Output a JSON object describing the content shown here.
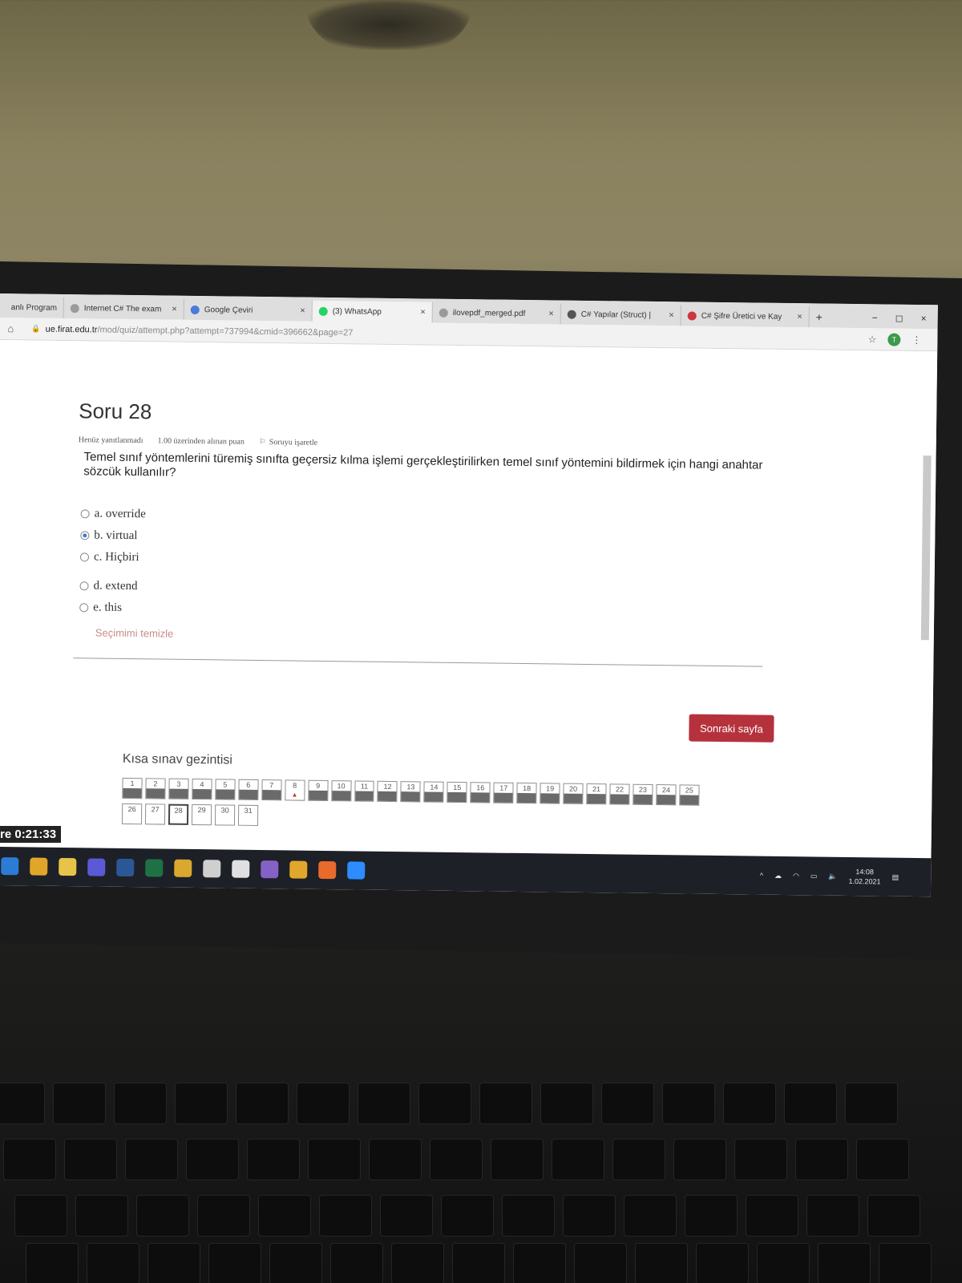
{
  "browser": {
    "tabs": [
      {
        "label": "anlı Program",
        "icon_color": "#888888",
        "active": false
      },
      {
        "label": "Internet C# The exam",
        "icon_color": "#9a9a9a",
        "active": false
      },
      {
        "label": "Google Çeviri",
        "icon_color": "#4a7bd8",
        "active": false
      },
      {
        "label": "(3) WhatsApp",
        "icon_color": "#25d366",
        "active": true
      },
      {
        "label": "ilovepdf_merged.pdf",
        "icon_color": "#9a9a9a",
        "active": false
      },
      {
        "label": "C# Yapılar (Struct) |",
        "icon_color": "#555555",
        "active": false
      },
      {
        "label": "C# Şifre Üretici ve Kay",
        "icon_color": "#d2343c",
        "active": false
      }
    ],
    "new_tab_label": "+",
    "close_label": "×",
    "window_controls": {
      "minimize": "−",
      "maximize": "◻",
      "close": "×"
    },
    "url_host": "ue.firat.edu.tr",
    "url_path": "/mod/quiz/attempt.php?attempt=737994&cmid=396662&page=27",
    "star_icon": "☆",
    "profile_initial": "T",
    "menu_icon": "⋮",
    "home_icon": "⌂",
    "lock_icon": "🔒"
  },
  "quiz": {
    "question_title": "Soru 28",
    "status": "Henüz yanıtlanmadı",
    "points": "1.00 üzerinden alınan puan",
    "flag_label": "Soruyu işaretle",
    "question_text": "Temel sınıf yöntemlerini türemiş sınıfta geçersiz kılma işlemi gerçekleştirilirken temel sınıf yöntemini bildirmek için hangi anahtar sözcük kullanılır?",
    "answers": [
      {
        "label": "a. override",
        "checked": false
      },
      {
        "label": "b. virtual",
        "checked": true
      },
      {
        "label": "c. Hiçbiri",
        "checked": false
      },
      {
        "label": "d. extend",
        "checked": false
      },
      {
        "label": "e. this",
        "checked": false
      }
    ],
    "clear_choice": "Seçimimi temizle",
    "next_button": "Sonraki sayfa",
    "nav_title": "Kısa sınav gezintisi",
    "nav_rows": [
      [
        "1",
        "2",
        "3",
        "4",
        "5",
        "6",
        "7",
        "8",
        "9",
        "10",
        "11",
        "12",
        "13",
        "14",
        "15",
        "16",
        "17",
        "18",
        "19",
        "20",
        "21",
        "22",
        "23",
        "24",
        "25"
      ],
      [
        "26",
        "27",
        "28",
        "29",
        "30",
        "31"
      ]
    ],
    "flagged_mark": "▲"
  },
  "timer": "re 0:21:33",
  "taskbar": {
    "icons": [
      {
        "name": "edge-icon",
        "color": "#2c7cd6"
      },
      {
        "name": "chrome-icon",
        "color": "#e1a629"
      },
      {
        "name": "file-explorer-icon",
        "color": "#e8c34a"
      },
      {
        "name": "store-icon",
        "color": "#5a5ad6"
      },
      {
        "name": "word-icon",
        "color": "#2b5797"
      },
      {
        "name": "excel-icon",
        "color": "#1e7145"
      },
      {
        "name": "photos-icon",
        "color": "#d8a82f"
      },
      {
        "name": "window-icon",
        "color": "#cfcfcf"
      },
      {
        "name": "3d-icon",
        "color": "#e0e0e0"
      },
      {
        "name": "visual-studio-icon",
        "color": "#8661c5"
      },
      {
        "name": "star-app-icon",
        "color": "#e0a72c"
      },
      {
        "name": "pen-app-icon",
        "color": "#e86a2c"
      },
      {
        "name": "zoom-icon",
        "color": "#2d8cff"
      }
    ],
    "time": "14:08",
    "date": "1.02.2021"
  }
}
